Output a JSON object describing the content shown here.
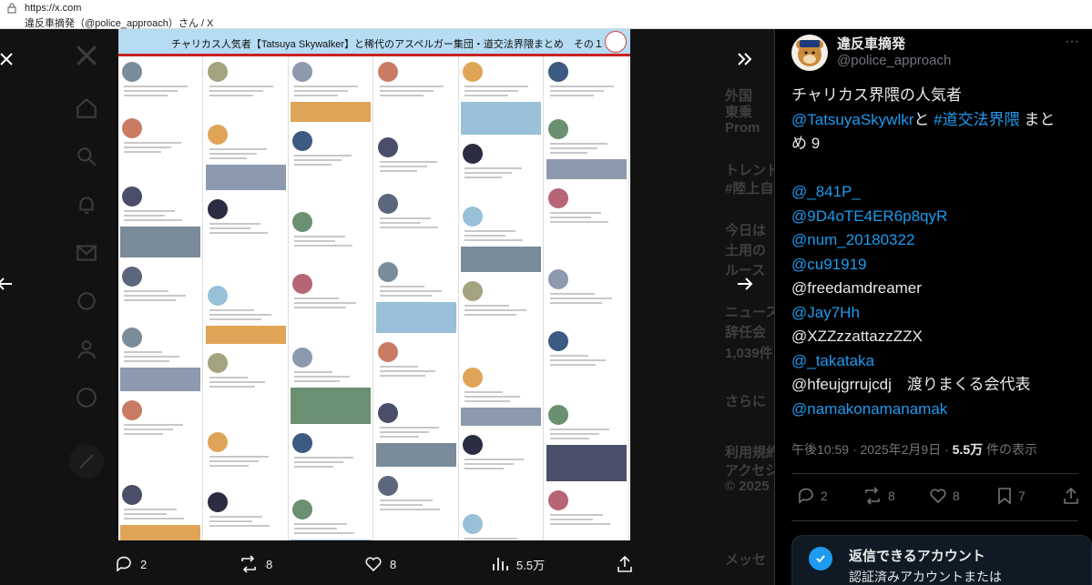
{
  "browser": {
    "url": "https://x.com",
    "title": "違反車摘発（@police_approach）さん / X"
  },
  "background": {
    "feed_lines": [
      "外国",
      "東乗",
      "Prom",
      "トレンド",
      "#陸上自",
      "今日は",
      "土用の",
      "ルース",
      "ニュース",
      "辞任会",
      "1,039件",
      "さらに",
      "利用規約",
      "アクセシ",
      "© 2025",
      "メッセ"
    ]
  },
  "media": {
    "header_title": "チャリカス人気者【Tatsuya Skywalker】と稀代のアスペルガー集団・道交法界隈まとめ　その１"
  },
  "media_actions": {
    "replies": "2",
    "reposts": "8",
    "likes": "8",
    "views": "5.5万"
  },
  "tweet": {
    "display_name": "違反車摘発",
    "handle": "@police_approach",
    "text_intro": "チャリカス界隈の人気者",
    "mention_main": "@TatsuyaSkywlkr",
    "connector": "と",
    "hashtag": "#道交法界隈",
    "text_outro": "まと",
    "text_outro2": "め 9",
    "accounts": [
      {
        "text": "@_841P_",
        "link": true
      },
      {
        "text": "@9D4oTE4ER6p8qyR",
        "link": true
      },
      {
        "text": "@num_20180322",
        "link": true
      },
      {
        "text": "@cu91919",
        "link": true
      },
      {
        "text": "@freedamdreamer",
        "link": false
      },
      {
        "text": "@Jay7Hh",
        "link": true
      },
      {
        "text": "@XZZzzattazzZZX",
        "link": false
      },
      {
        "text": "@_takataka",
        "link": true
      },
      {
        "text": "@hfeujgrrujcdj　渡りまくる会代表",
        "link": false
      },
      {
        "text": "@namakonamanamak",
        "link": true
      }
    ],
    "timestamp": "午後10:59 · 2025年2月9日 · ",
    "views_count": "5.5万",
    "views_label": " 件の表示",
    "replies": "2",
    "reposts": "8",
    "likes": "8",
    "bookmarks": "7"
  },
  "reply_card": {
    "title": "返信できるアカウント",
    "subtitle": "認証済みアカウントまたは"
  },
  "colors": {
    "accent": "#1d9bf0",
    "text": "#e7e9ea",
    "muted": "#71767b",
    "header_band": "#b5dcf3",
    "header_rule": "#cc2020"
  }
}
